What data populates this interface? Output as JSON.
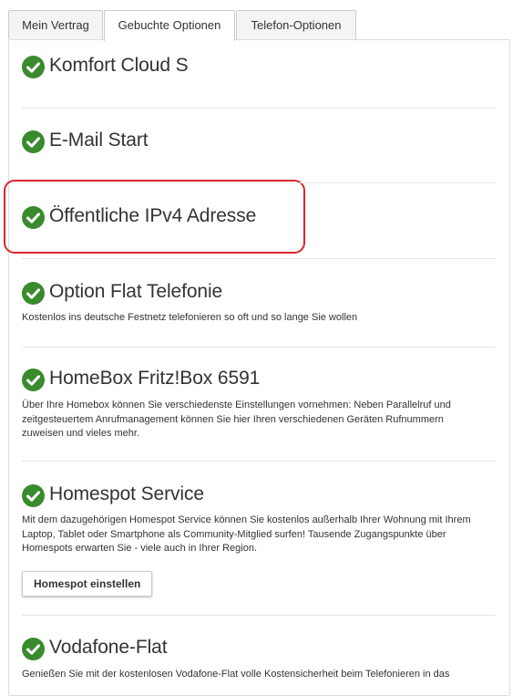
{
  "tabs": [
    {
      "label": "Mein Vertrag",
      "active": false
    },
    {
      "label": "Gebuchte Optionen",
      "active": true
    },
    {
      "label": "Telefon-Optionen",
      "active": false
    }
  ],
  "options": [
    {
      "title": "Komfort Cloud S",
      "description": ""
    },
    {
      "title": "E-Mail Start",
      "description": ""
    },
    {
      "title": "Öffentliche IPv4 Adresse",
      "description": "",
      "highlighted": true
    },
    {
      "title": "Option Flat Telefonie",
      "description": "Kostenlos ins deutsche Festnetz telefonieren so oft und so lange Sie wollen"
    },
    {
      "title": "HomeBox Fritz!Box 6591",
      "description": "Über Ihre Homebox können Sie verschiedenste Einstellungen vornehmen: Neben Parallelruf und zeitgesteuertem Anrufmanagement können Sie hier Ihren verschiedenen Geräten Rufnummern zuweisen und vieles mehr."
    },
    {
      "title": "Homespot Service",
      "description": "Mit dem dazugehörigen Homespot Service können Sie kostenlos außerhalb Ihrer Wohnung mit Ihrem Laptop, Tablet oder Smartphone als Community-Mitglied surfen! Tausende Zugangspunkte über Homespots erwarten Sie - viele auch in Ihrer Region.",
      "button": "Homespot einstellen"
    },
    {
      "title": "Vodafone-Flat",
      "description": "Genießen Sie mit der kostenlosen Vodafone-Flat volle Kostensicherheit beim Telefonieren in das"
    }
  ],
  "colors": {
    "check": "#3a8a2e",
    "highlight": "#d9262c"
  }
}
